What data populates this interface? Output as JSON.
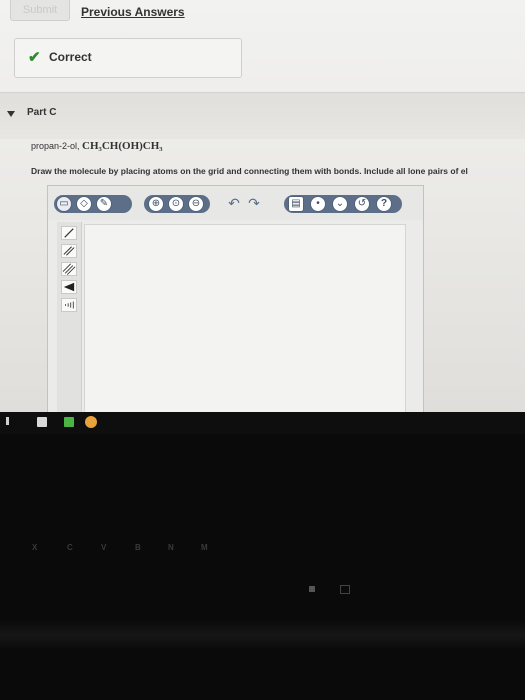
{
  "header": {
    "submit_label": "Submit",
    "previous_answers_label": "Previous Answers"
  },
  "feedback": {
    "correct_label": "Correct"
  },
  "part": {
    "title": "Part C",
    "compound_name": "propan-2-ol,",
    "compound_formula": "CH₃CH(OH)CH₃",
    "instruction": "Draw the molecule by placing atoms on the grid and connecting them with bonds. Include all lone pairs of el"
  },
  "toolbar": {
    "icons": [
      "select-lasso-icon",
      "eraser-icon",
      "pencil-icon",
      "zoom-in-icon",
      "zoom-fit-icon",
      "zoom-out-icon",
      "undo-icon",
      "redo-icon",
      "template-icon",
      "info-icon",
      "more-icon",
      "reset-icon",
      "help-icon"
    ],
    "help_label": "?"
  },
  "sidebar_tools": [
    "single-bond-tool",
    "double-bond-tool",
    "triple-bond-tool",
    "wedge-bond-tool",
    "dash-bond-tool"
  ],
  "keyboard": {
    "row_letters": [
      "X",
      "C",
      "V",
      "B",
      "N",
      "M"
    ]
  },
  "colors": {
    "toolbar_group": "#5d6f88",
    "check": "#2f8a2f",
    "taskbar_chrome": "#e8a33a",
    "taskbar_green": "#4bb543"
  }
}
